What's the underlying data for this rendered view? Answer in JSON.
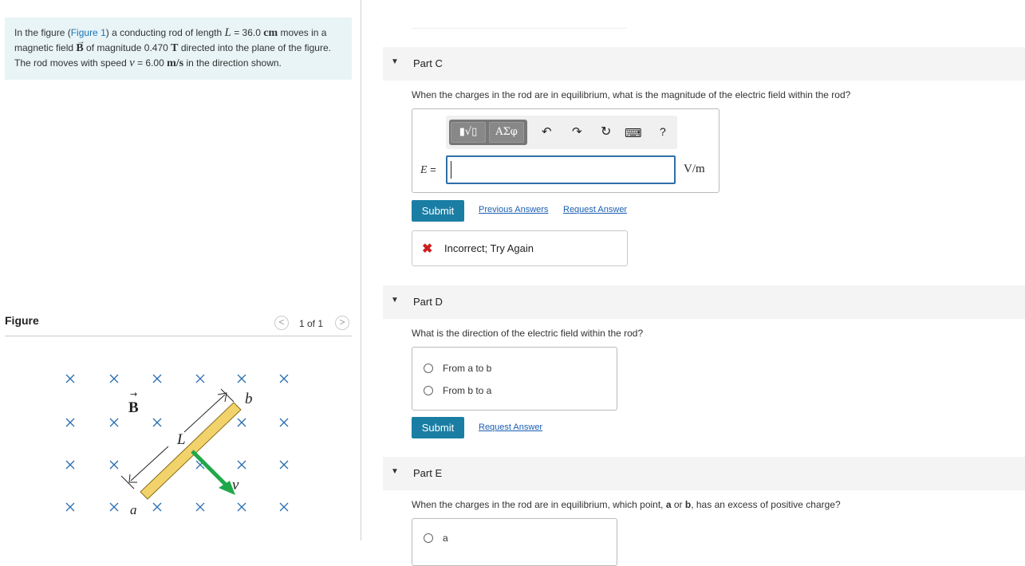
{
  "problem": {
    "line1_a": "In the figure (",
    "figure_link": "Figure 1",
    "line1_b": ") a conducting rod of length ",
    "L_symbol": "L",
    "L_eq": " = 36.0 ",
    "L_unit": "cm",
    "line1_c": " moves in a",
    "line2_a": "magnetic field ",
    "B_symbol": "B",
    "line2_b": " of magnitude 0.470 ",
    "B_unit": "T",
    "line2_c": " directed into the plane of the figure.",
    "line3_a": "The rod moves with speed ",
    "v_symbol": "v",
    "v_eq": " = 6.00 ",
    "v_unit": "m/s",
    "line3_b": " in the direction shown."
  },
  "figure_panel": {
    "title": "Figure",
    "counter": "1 of 1",
    "prev_icon": "<",
    "next_icon": ">",
    "labels": {
      "B": "B",
      "L": "L",
      "a": "a",
      "b": "b",
      "v": "v"
    }
  },
  "part_c": {
    "title": "Part C",
    "question": "When the charges in the rod are in equilibrium, what is the magnitude of the electric field within the rod?",
    "toolbar": {
      "radical_label": "▮√▯",
      "greek_label": "ΑΣφ",
      "undo_icon": "↶",
      "redo_icon": "↷",
      "reset_icon": "↻",
      "keyboard_icon": "⌨",
      "help_label": "?"
    },
    "variable_label": "E =",
    "input_value": "",
    "unit": "V/m",
    "submit_label": "Submit",
    "previous_answers_label": "Previous Answers",
    "request_answer_label": "Request Answer",
    "feedback_icon": "✖",
    "feedback_text": "Incorrect; Try Again"
  },
  "part_d": {
    "title": "Part D",
    "question": "What is the direction of the electric field within the rod?",
    "options": [
      "From a to b",
      "From b to a"
    ],
    "submit_label": "Submit",
    "request_answer_label": "Request Answer"
  },
  "part_e": {
    "title": "Part E",
    "question_a": "When the charges in the rod are in equilibrium, which point, ",
    "point_a": "a",
    "question_or": " or ",
    "point_b": "b",
    "question_b": ", has an excess of positive charge?",
    "options": [
      "a"
    ]
  },
  "colors": {
    "problem_bg": "#e8f4f6",
    "link": "#1a5fb4",
    "submit_bg": "#1a7ea4",
    "error": "#cc1f1f",
    "velocity_arrow": "#1fa84a",
    "rod_fill": "#f2d36b",
    "field_x": "#2a6db0"
  }
}
